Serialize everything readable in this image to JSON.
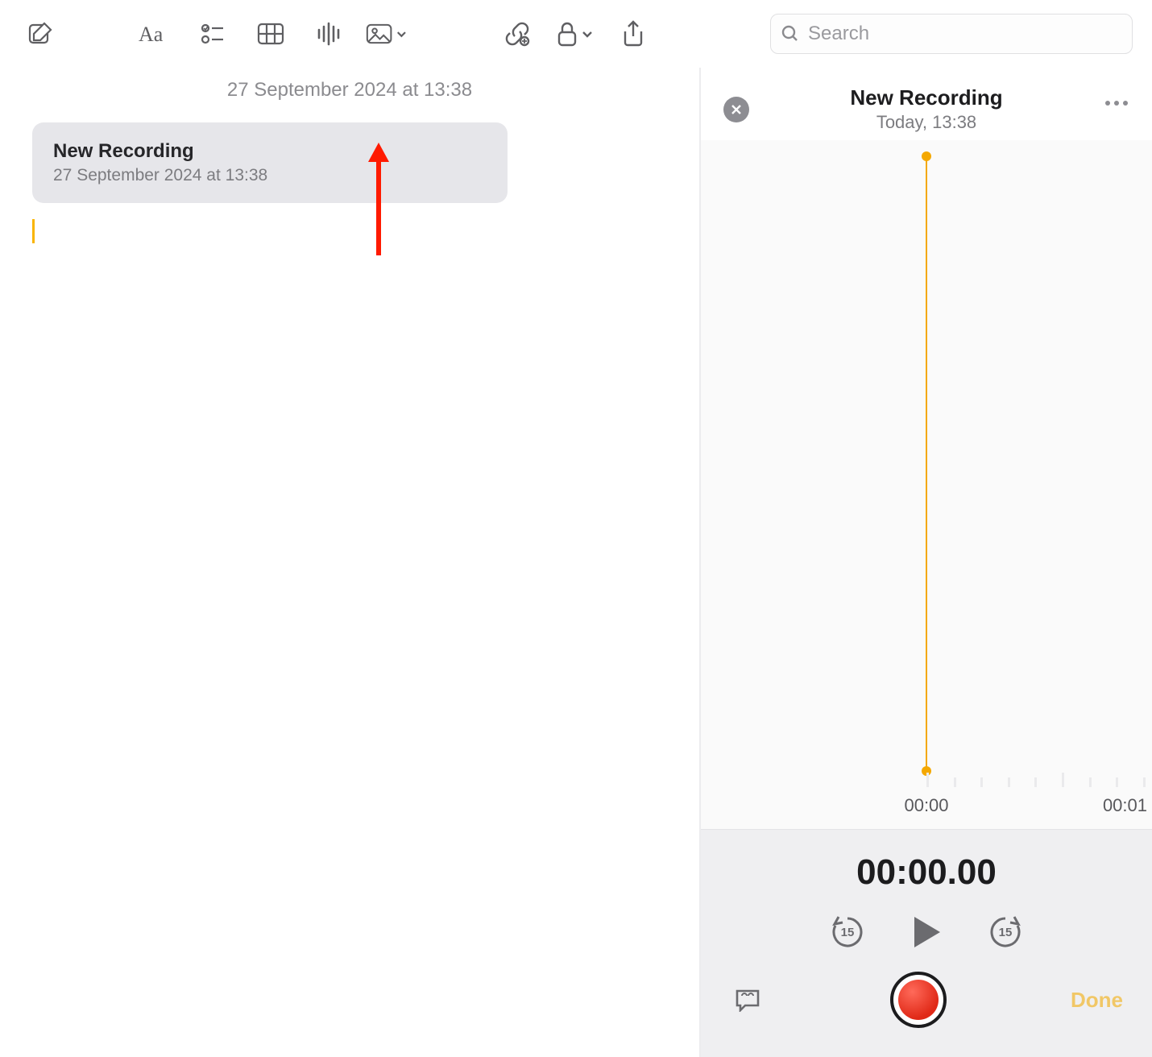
{
  "toolbar": {
    "icons": {
      "compose": "compose-icon",
      "text_format": "text-format-icon",
      "checklist": "checklist-icon",
      "table": "table-icon",
      "audio": "audio-wave-icon",
      "media": "photo-icon",
      "link": "link-icon",
      "lock": "lock-icon",
      "share": "share-icon"
    }
  },
  "search": {
    "placeholder": "Search",
    "value": ""
  },
  "note": {
    "header_date": "27 September 2024 at 13:38",
    "card": {
      "title": "New Recording",
      "subtitle": "27 September 2024 at 13:38"
    }
  },
  "recorder": {
    "title": "New Recording",
    "subtitle": "Today, 13:38",
    "waveform_times": {
      "start": "00:00",
      "end": "00:01"
    },
    "timecode": "00:00.00",
    "skip_seconds": "15",
    "done_label": "Done"
  },
  "colors": {
    "accent_yellow": "#f4a800",
    "record_red": "#e02917",
    "muted_text": "#8b8b8f"
  }
}
